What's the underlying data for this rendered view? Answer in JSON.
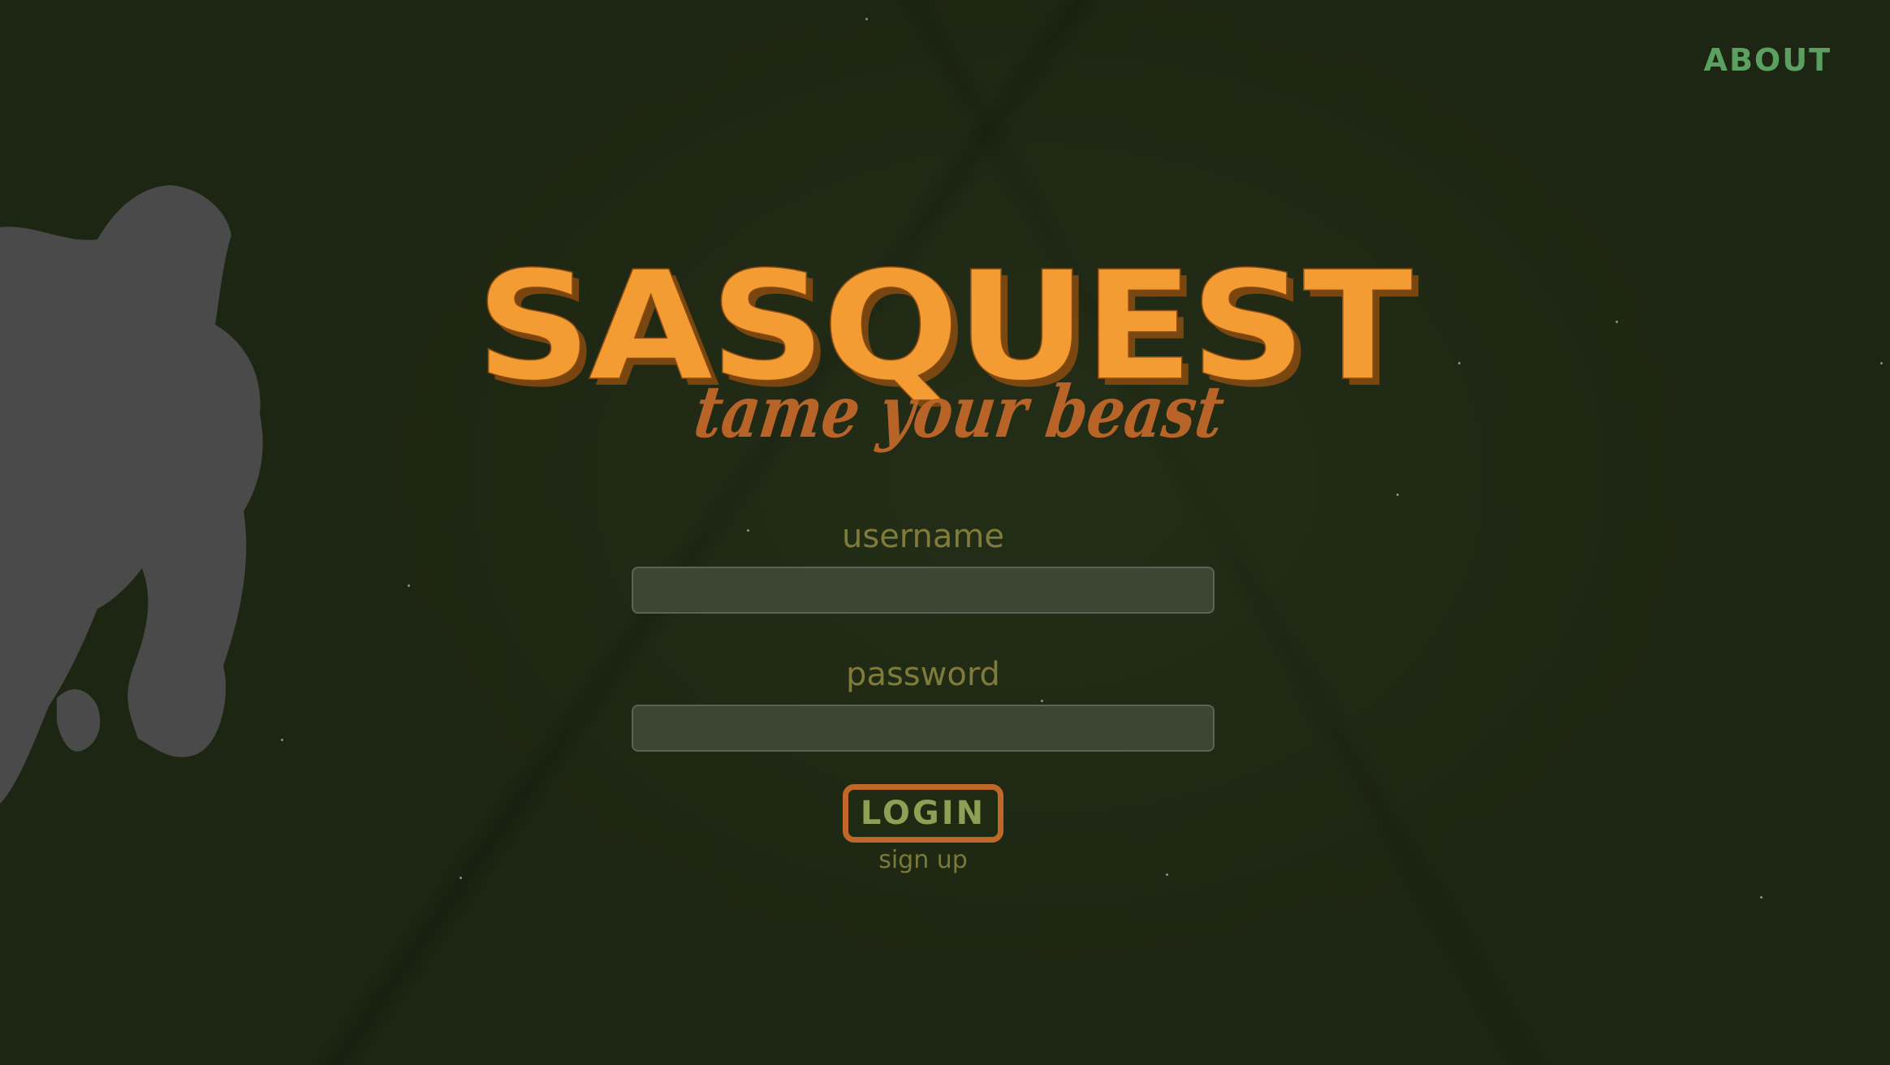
{
  "nav": {
    "about_label": "ABOUT"
  },
  "logo": {
    "title": "SASQUEST",
    "tagline": "tame your beast"
  },
  "form": {
    "username_label": "username",
    "username_value": "",
    "password_label": "password",
    "password_value": "",
    "login_label": "LOGIN",
    "signup_label": "sign up"
  },
  "colors": {
    "background": "#1d2612",
    "logo_orange": "#f39c34",
    "tagline_orange": "#b86428",
    "about_green": "#5ba060",
    "label_olive": "#7f7c3a",
    "input_fill": "#3d4533",
    "button_border": "#c0672a",
    "button_text": "#8ea056",
    "silhouette_gray": "#4a4a4a"
  },
  "icons": {
    "mascot": "bigfoot-silhouette-icon"
  }
}
